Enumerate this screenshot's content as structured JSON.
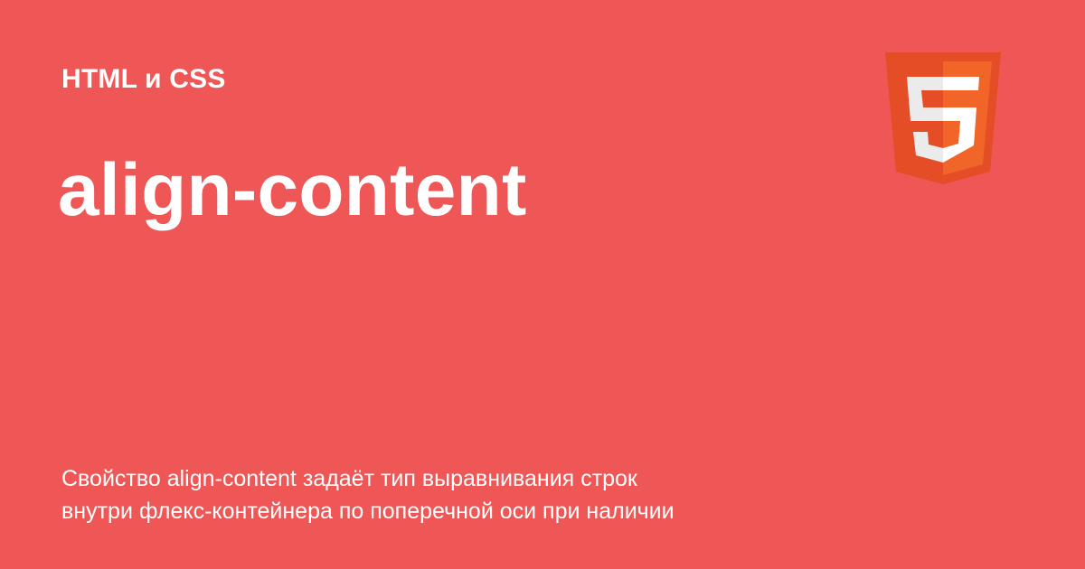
{
  "page": {
    "background_color": "#ef5656"
  },
  "header": {
    "section_label": "HTML и CSS"
  },
  "main": {
    "title": "align-content",
    "description_lines": [
      "Свойство align-content задаёт тип выравнивания строк",
      "внутри флекс-контейнера по поперечной оси при наличии"
    ]
  },
  "logo": {
    "icon_name": "html5-icon",
    "digit": "5",
    "colors": {
      "outer": "#e44d26",
      "inner": "#f16529",
      "glyph_left": "#ebebeb",
      "glyph_right": "#ffffff"
    }
  }
}
